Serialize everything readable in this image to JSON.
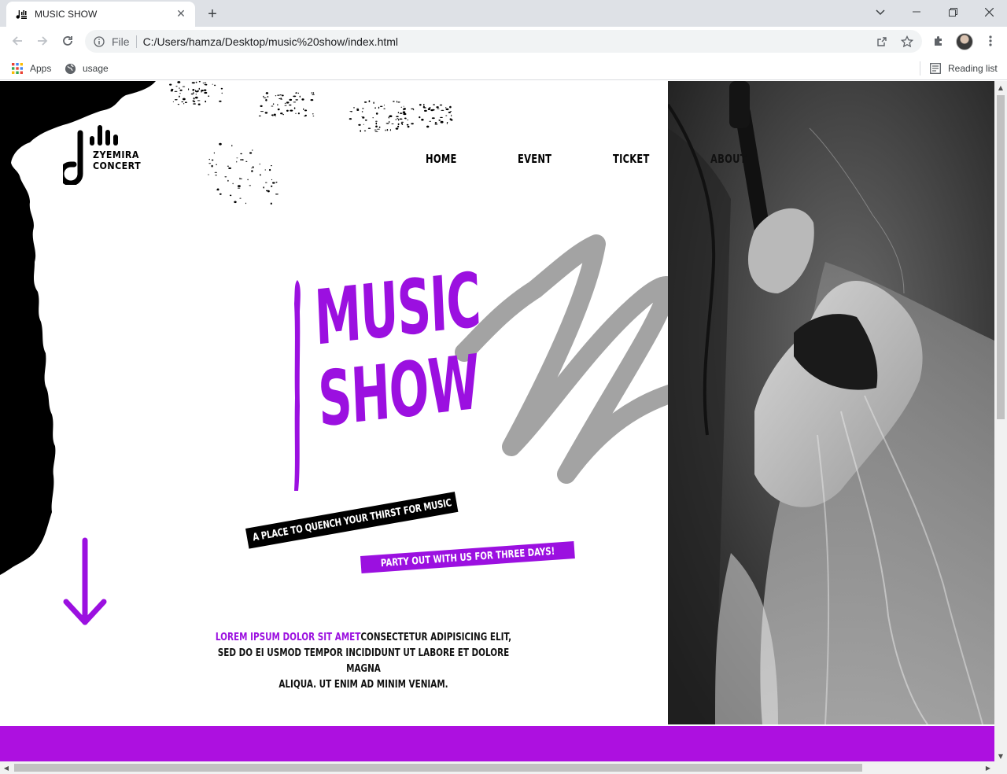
{
  "browser": {
    "tab_title": "MUSIC SHOW",
    "file_chip": "File",
    "url": "C:/Users/hamza/Desktop/music%20show/index.html",
    "bookmarks": [
      {
        "label": "Apps",
        "icon": "apps-grid-icon"
      },
      {
        "label": "usage",
        "icon": "globe-icon"
      }
    ],
    "reading_list": "Reading list"
  },
  "site": {
    "logo_line1": "ZYEMIRA",
    "logo_line2": "CONCERT",
    "nav": [
      "HOME",
      "EVENT",
      "TICKET",
      "ABOUT"
    ],
    "hero_line1": "MUSIC",
    "hero_line2": "SHOW",
    "tagline_black": "A PLACE TO QUENCH YOUR THIRST FOR MUSIC",
    "tagline_purple": "PARTY OUT WITH US FOR THREE DAYS!",
    "paragraph_accent": "LOREM IPSUM DOLOR SIT AMET",
    "paragraph_line1": "CONSECTETUR ADIPISICING ELIT,",
    "paragraph_line2": "SED DO EI USMOD TEMPOR INCIDIDUNT UT LABORE ET DOLORE MAGNA",
    "paragraph_line3": "ALIQUA. UT ENIM AD MINIM VENIAM."
  },
  "colors": {
    "accent_purple": "#9b10e0",
    "footer_purple": "#ad10e0",
    "scribble_gray": "#a3a3a3"
  }
}
